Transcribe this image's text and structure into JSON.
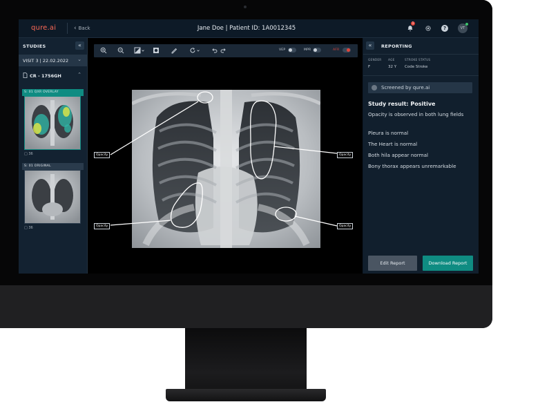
{
  "app": {
    "logo": "qure.ai",
    "back_label": "Back",
    "patient_header": "Jane Doe | Patient ID: 1A0012345",
    "notification_count": "1",
    "avatar_initials": "VT"
  },
  "sidebar": {
    "header": "STUDIES",
    "visit": "VISIT 3 | 22.02.2022",
    "study": "CR - 1756GH",
    "series": [
      {
        "title": "S: 01  QXR OVERLAY",
        "count": "36"
      },
      {
        "title": "S: 01  ORIGINAL",
        "count": "36"
      }
    ]
  },
  "toolbar": {
    "tools": [
      "zoom-in",
      "zoom-out",
      "contrast",
      "invert",
      "measure",
      "rotate",
      "undo",
      "redo"
    ],
    "toggles": [
      {
        "label": "VEP",
        "on": false
      },
      {
        "label": "MPR",
        "on": false
      },
      {
        "label": "AFR",
        "on": true
      }
    ]
  },
  "viewer": {
    "annotation_label": "Opacity"
  },
  "report": {
    "title": "REPORTING",
    "meta": {
      "gender_label": "GENDER",
      "gender": "F",
      "age_label": "AGE",
      "age": "32 Y",
      "stroke_label": "STROKE STATUS",
      "stroke": "Code Stroke"
    },
    "screened_by": "Screened by qure.ai",
    "study_result": "Study result: Positive",
    "findings": [
      "Opacity is observed in both lung fields",
      "Pleura is normal",
      "The Heart is normal",
      "Both hila appear normal",
      "Bony thorax appears unremarkable"
    ],
    "edit_button": "Edit Report",
    "download_button": "Download Report"
  },
  "colors": {
    "brand": "#ff6a56",
    "accent_teal": "#0f8c82",
    "alert_red": "#e0453b",
    "panel_bg": "#111f2d"
  }
}
